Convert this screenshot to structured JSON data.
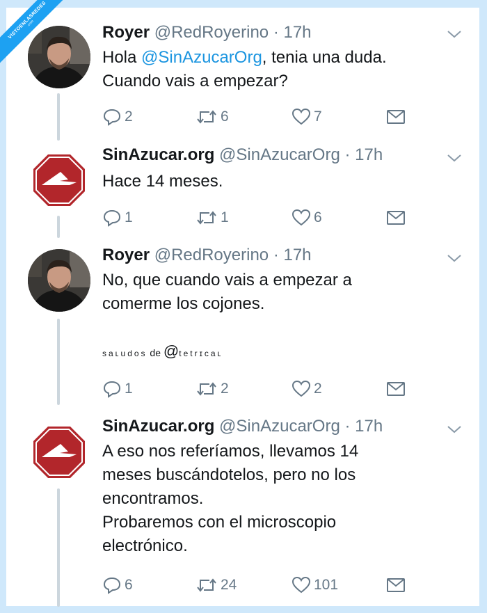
{
  "watermark_ribbon": {
    "line1": "VISTOENLASREDES",
    "line2": ".com"
  },
  "colors": {
    "link": "#1b95e0",
    "secondary": "#657786",
    "thread_line": "#ccd6dd",
    "logo_red": "#b2262b",
    "frame": "#cfe8fb"
  },
  "tweets": [
    {
      "name": "Royer",
      "handle": "@RedRoyerino",
      "dot": "·",
      "time": "17h",
      "body_pre": "Hola ",
      "mention": "@SinAzucarOrg",
      "body_post": ", tenia una duda.\nCuando vais a empezar?",
      "replies": "2",
      "retweets": "6",
      "likes": "7",
      "avatar": "profile-photo"
    },
    {
      "name": "SinAzucar.org",
      "handle": "@SinAzucarOrg",
      "dot": "·",
      "time": "17h",
      "body": "Hace 14 meses.",
      "replies": "1",
      "retweets": "1",
      "likes": "6",
      "avatar": "stop-sign-logo"
    },
    {
      "name": "Royer",
      "handle": "@RedRoyerino",
      "dot": "·",
      "time": "17h",
      "body": "No, que cuando vais a empezar a\ncomerme los cojones.",
      "replies": "1",
      "retweets": "2",
      "likes": "2",
      "avatar": "profile-photo"
    },
    {
      "name": "SinAzucar.org",
      "handle": "@SinAzucarOrg",
      "dot": "·",
      "time": "17h",
      "body": "A eso nos referíamos, llevamos 14\nmeses buscándotelos, pero no los\nencontramos.\nProbaremos con el microscopio\nelectrónico.",
      "replies": "6",
      "retweets": "24",
      "likes": "101",
      "avatar": "stop-sign-logo"
    }
  ],
  "watermark_text": {
    "part1": "saʟudos",
    "part2": " de ",
    "at": "@",
    "part3": "tetrɪcaʟ"
  },
  "icons": [
    "reply-icon",
    "retweet-icon",
    "like-icon",
    "message-icon",
    "chevron-down-icon"
  ]
}
